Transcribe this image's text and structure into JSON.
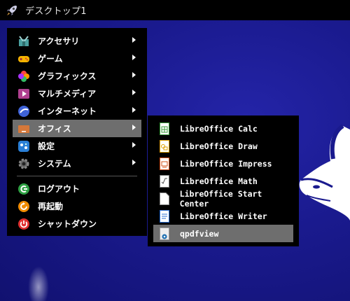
{
  "taskbar": {
    "launcher_icon": "rocket-icon",
    "desktop_label": "デスクトップ1"
  },
  "main_menu": {
    "items": [
      {
        "label": "アクセサリ",
        "icon": "accessories-icon",
        "submenu": true
      },
      {
        "label": "ゲーム",
        "icon": "gamepad-icon",
        "submenu": true
      },
      {
        "label": "グラフィックス",
        "icon": "graphics-icon",
        "submenu": true
      },
      {
        "label": "マルチメディア",
        "icon": "multimedia-icon",
        "submenu": true
      },
      {
        "label": "インターネット",
        "icon": "internet-icon",
        "submenu": true
      },
      {
        "label": "オフィス",
        "icon": "office-icon",
        "submenu": true,
        "active": true
      },
      {
        "label": "設定",
        "icon": "settings-icon",
        "submenu": true
      },
      {
        "label": "システム",
        "icon": "system-gear-icon",
        "submenu": true
      }
    ],
    "session_items": [
      {
        "label": "ログアウト",
        "icon": "logout-icon"
      },
      {
        "label": "再起動",
        "icon": "restart-icon"
      },
      {
        "label": "シャットダウン",
        "icon": "shutdown-icon"
      }
    ]
  },
  "office_submenu": {
    "items": [
      {
        "label": "LibreOffice Calc",
        "icon": "calc-icon"
      },
      {
        "label": "LibreOffice Draw",
        "icon": "draw-icon"
      },
      {
        "label": "LibreOffice Impress",
        "icon": "impress-icon"
      },
      {
        "label": "LibreOffice Math",
        "icon": "math-icon"
      },
      {
        "label": "LibreOffice Start Center",
        "icon": "start-center-icon"
      },
      {
        "label": "LibreOffice Writer",
        "icon": "writer-icon"
      },
      {
        "label": "qpdfview",
        "icon": "pdf-viewer-icon",
        "active": true
      }
    ]
  },
  "colors": {
    "menu_bg": "#000000",
    "highlight": "#6e6e6e",
    "desktop": "#1a1a8e"
  }
}
